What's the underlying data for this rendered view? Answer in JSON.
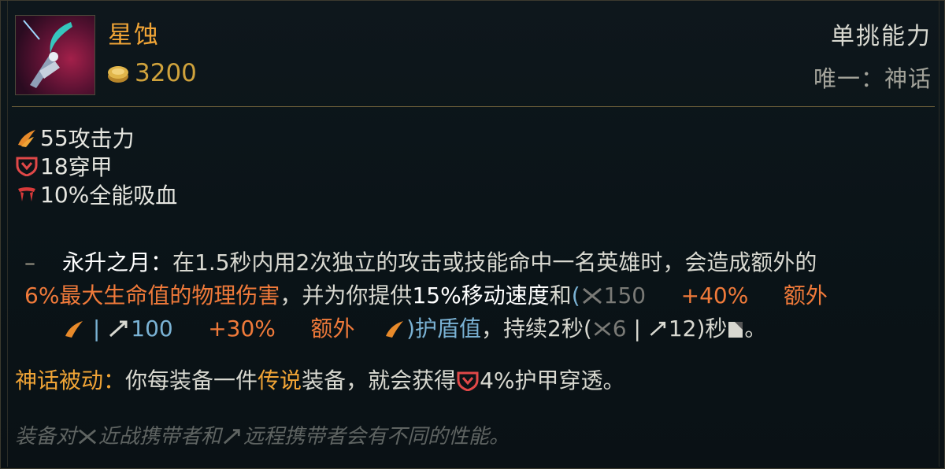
{
  "item": {
    "name": "星蚀",
    "cost": "3200",
    "category": "单挑能力",
    "unique_type": "唯一：神话"
  },
  "stats": [
    {
      "icon": "attack-damage-icon",
      "value": "55",
      "label": "攻击力"
    },
    {
      "icon": "armor-penetration-icon",
      "value": "18",
      "label": "穿甲"
    },
    {
      "icon": "omnivamp-icon",
      "value": "10%",
      "label": "全能吸血"
    }
  ],
  "passive": {
    "dash": "–",
    "name": "永升之月",
    "colon": "：",
    "desc_1": "在1.5秒内用2次独立的攻击或技能命中一名英雄时，会造成额外的",
    "damage": "6%最大生命值的物理伤害",
    "desc_2": "，并为你提供",
    "ms": "15%移动速度",
    "and": "和",
    "shield_open": "(",
    "melee_shield": "150",
    "melee_bonus": "+40%",
    "bonus_word_1": "额外",
    "sep": "|",
    "ranged_shield": "100",
    "ranged_bonus": "+30%",
    "bonus_word_2": "额外",
    "shield_close": ")",
    "shield_label": "护盾值",
    "desc_3": "，持续2秒(",
    "melee_duration": "6",
    "sep2": "|",
    "ranged_duration": "12",
    "desc_4": ")秒",
    "period": "。"
  },
  "mythic": {
    "label": "神话被动",
    "colon": "：",
    "desc_1": "你每装备一件",
    "legendary": "传说",
    "desc_2": "装备，就会获得",
    "value": "4%护甲穿透",
    "period": "。"
  },
  "footer": {
    "part_1": "装备对",
    "part_2": "近战携带者和",
    "part_3": "远程携带者会有不同的性能。"
  },
  "colors": {
    "name": "#f0a436",
    "highlight_damage": "#f07a3a",
    "highlight_shield": "#7ab2d4",
    "divider": "#6d5f3a"
  }
}
